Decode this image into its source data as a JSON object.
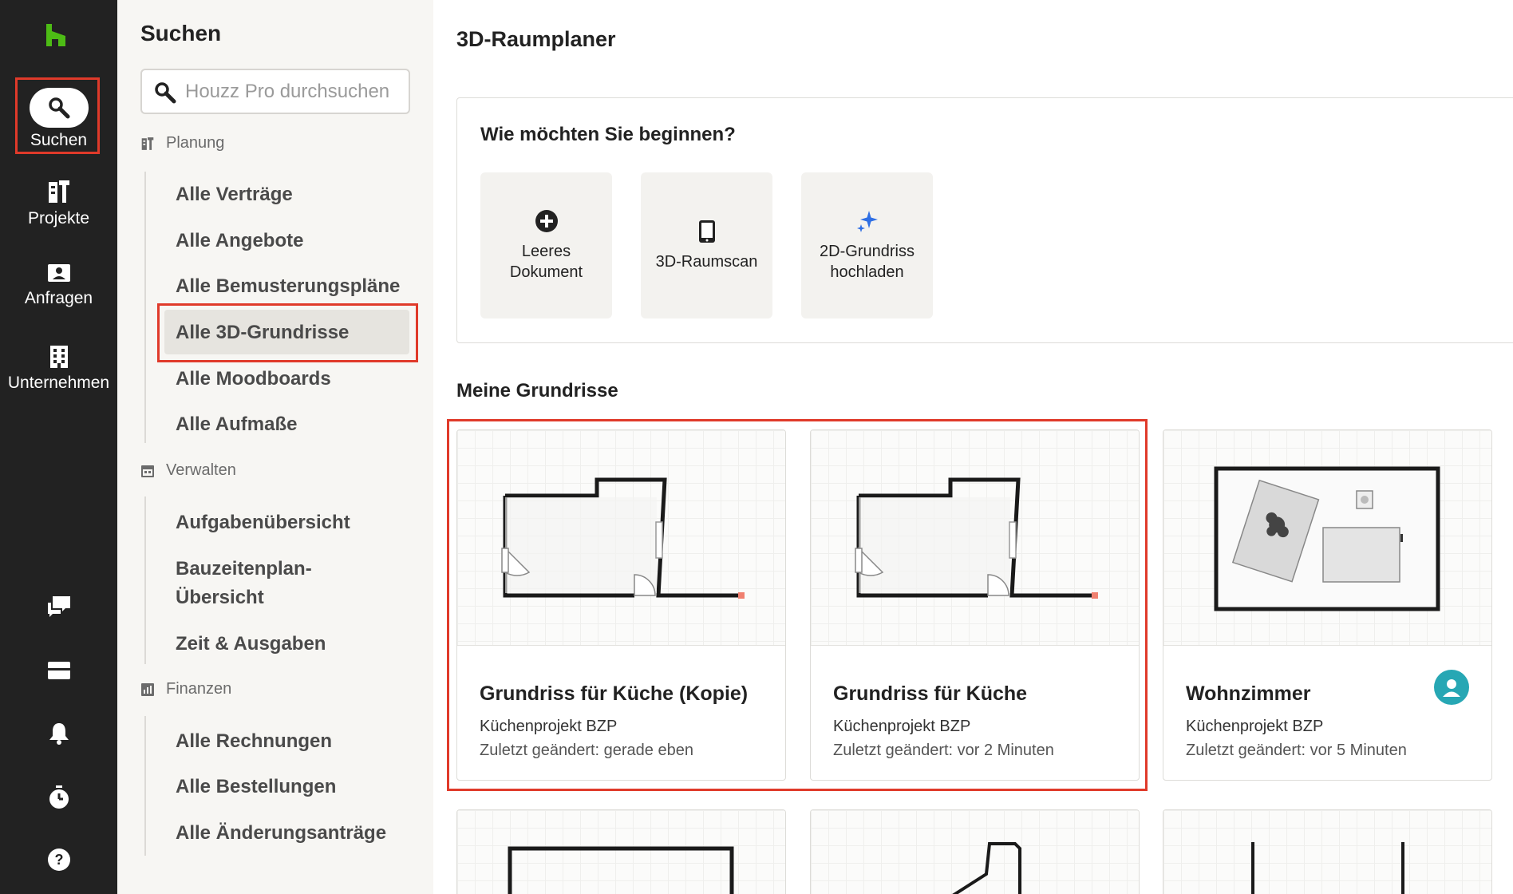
{
  "rail": {
    "items": [
      {
        "label": "Suchen",
        "icon": "search-icon"
      },
      {
        "label": "Projekte",
        "icon": "projects-icon"
      },
      {
        "label": "Anfragen",
        "icon": "inquiries-icon"
      },
      {
        "label": "Unternehmen",
        "icon": "building-icon"
      }
    ],
    "bottom_icons": [
      "chat-icon",
      "inbox-icon",
      "bell-icon",
      "timer-icon",
      "help-icon"
    ],
    "logo_color": "#4dbc15"
  },
  "sidebar": {
    "title": "Suchen",
    "search_placeholder": "Houzz Pro durchsuchen",
    "sections": [
      {
        "heading": "Planung",
        "items": [
          "Alle Verträge",
          "Alle Angebote",
          "Alle Bemusterungspläne",
          "Alle 3D-Grundrisse",
          "Alle Moodboards",
          "Alle Aufmaße"
        ]
      },
      {
        "heading": "Verwalten",
        "items": [
          "Aufgabenübersicht",
          "Bauzeitenplan-",
          "Übersicht",
          "Zeit & Ausgaben"
        ]
      },
      {
        "heading": "Finanzen",
        "items": [
          "Alle Rechnungen",
          "Alle Bestellungen",
          "Alle Änderungsanträge"
        ]
      }
    ],
    "active_item": "Alle 3D-Grundrisse"
  },
  "main": {
    "title": "3D-Raumplaner",
    "start": {
      "question": "Wie möchten Sie beginnen?",
      "options": [
        {
          "line1": "Leeres",
          "line2": "Dokument",
          "icon": "plus-circle-icon"
        },
        {
          "line1": "3D-Raumscan",
          "line2": "",
          "icon": "tablet-icon"
        },
        {
          "line1": "2D-Grundriss",
          "line2": "hochladen",
          "icon": "sparkle-icon"
        }
      ]
    },
    "my_plans_title": "Meine Grundrisse",
    "plans": [
      {
        "name": "Grundriss für Küche (Kopie)",
        "project": "Küchenprojekt BZP",
        "modified": "Zuletzt geändert: gerade eben"
      },
      {
        "name": "Grundriss für Küche",
        "project": "Küchenprojekt BZP",
        "modified": "Zuletzt geändert: vor 2 Minuten"
      },
      {
        "name": "Wohnzimmer",
        "project": "Küchenprojekt BZP",
        "modified": "Zuletzt geändert: vor 5 Minuten",
        "shared_avatar": true
      }
    ]
  },
  "colors": {
    "highlight": "#e03a2a",
    "rail_bg": "#222222",
    "sidebar_bg": "#f7f6f3",
    "avatar": "#27a7b4",
    "sparkle": "#2f6fe4"
  }
}
